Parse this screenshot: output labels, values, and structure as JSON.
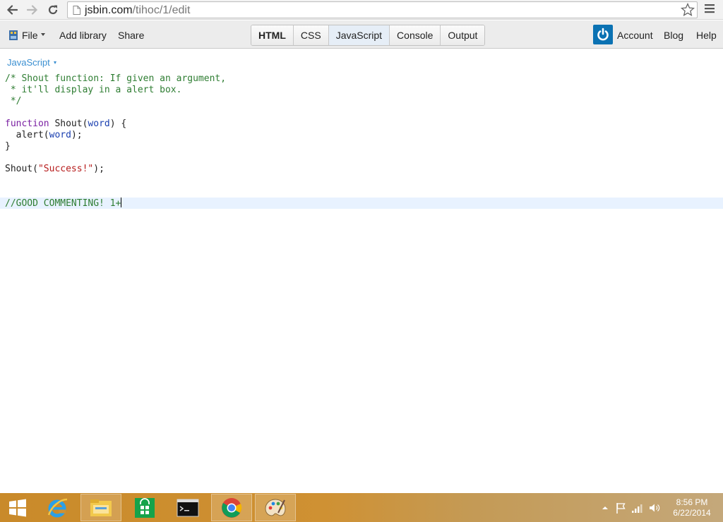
{
  "browser": {
    "url_host": "jsbin.com",
    "url_path": "/tihoc/1/edit"
  },
  "toolbar": {
    "file_label": "File",
    "add_library_label": "Add library",
    "share_label": "Share",
    "panels": [
      "HTML",
      "CSS",
      "JavaScript",
      "Console",
      "Output"
    ],
    "active_panel": "JavaScript",
    "account_label": "Account",
    "blog_label": "Blog",
    "help_label": "Help"
  },
  "editor": {
    "language_label": "JavaScript",
    "code": {
      "l1": "/* Shout function: If given an argument,",
      "l2": " * it'll display in a alert box.",
      "l3": " */",
      "l5_kw": "function",
      "l5_name": "Shout",
      "l5_param": "word",
      "l6_call": "alert",
      "l6_arg": "word",
      "l7": "}",
      "l9_call": "Shout",
      "l9_str": "\"Success!\"",
      "l12": "//GOOD COMMENTING! 1+"
    }
  },
  "taskbar": {
    "apps": [
      "windows-start",
      "internet-explorer",
      "file-explorer",
      "store",
      "command-prompt",
      "chrome",
      "paint"
    ],
    "time": "8:56 PM",
    "date": "6/22/2014"
  },
  "colors": {
    "accent": "#0b72b3",
    "link": "#3a8fd1",
    "comment": "#2e7d32",
    "keyword": "#7a1fa2",
    "string": "#b71c1c",
    "variable": "#1a3fb0"
  }
}
